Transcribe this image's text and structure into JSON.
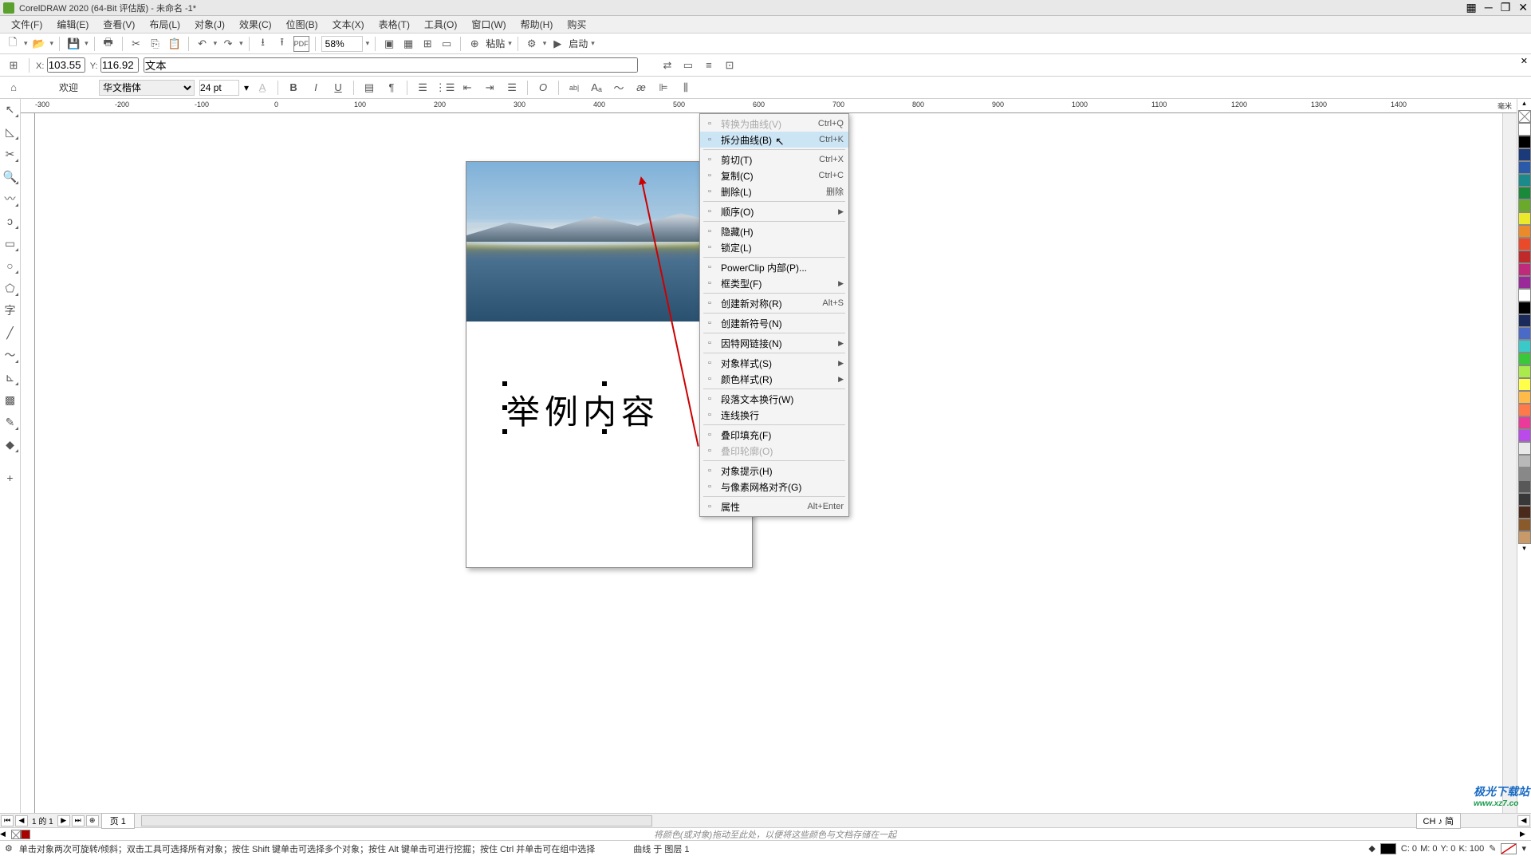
{
  "title": "CorelDRAW 2020 (64-Bit 评估版) - 未命名 -1*",
  "menubar": [
    "文件(F)",
    "编辑(E)",
    "查看(V)",
    "布局(L)",
    "对象(J)",
    "效果(C)",
    "位图(B)",
    "文本(X)",
    "表格(T)",
    "工具(O)",
    "窗口(W)",
    "帮助(H)",
    "购买"
  ],
  "toolbar1": {
    "zoom": "58%",
    "paste_label": "粘贴",
    "launch": "启动"
  },
  "propbar1": {
    "x_label": "X:",
    "x_val": "103.55",
    "y_label": "Y:",
    "y_val": "116.92",
    "obj_label": "文本"
  },
  "propbar2": {
    "greet": "欢迎",
    "font": "华文楷体",
    "fontsize": "24 pt"
  },
  "canvas": {
    "sample_text": "举例内容",
    "ruler_ticks": [
      "-300",
      "-200",
      "-100",
      "0",
      "100",
      "200",
      "300",
      "400",
      "500",
      "600",
      "700",
      "800",
      "900",
      "1000",
      "1100",
      "1200",
      "1300",
      "1400"
    ],
    "ruler_unit": "毫米"
  },
  "context_menu": {
    "items": [
      {
        "label": "转换为曲线(V)",
        "shortcut": "Ctrl+Q",
        "disabled": true
      },
      {
        "label": "拆分曲线(B)",
        "shortcut": "Ctrl+K",
        "highlight": true
      },
      {
        "sep": true
      },
      {
        "label": "剪切(T)",
        "shortcut": "Ctrl+X"
      },
      {
        "label": "复制(C)",
        "shortcut": "Ctrl+C"
      },
      {
        "label": "删除(L)",
        "shortcut": "删除"
      },
      {
        "sep": true
      },
      {
        "label": "顺序(O)",
        "submenu": true
      },
      {
        "sep": true
      },
      {
        "label": "隐藏(H)"
      },
      {
        "label": "锁定(L)"
      },
      {
        "sep": true
      },
      {
        "label": "PowerClip 内部(P)..."
      },
      {
        "label": "框类型(F)",
        "submenu": true
      },
      {
        "sep": true
      },
      {
        "label": "创建新对称(R)",
        "shortcut": "Alt+S"
      },
      {
        "sep": true
      },
      {
        "label": "创建新符号(N)"
      },
      {
        "sep": true
      },
      {
        "label": "因特网链接(N)",
        "submenu": true
      },
      {
        "sep": true
      },
      {
        "label": "对象样式(S)",
        "submenu": true
      },
      {
        "label": "颜色样式(R)",
        "submenu": true
      },
      {
        "sep": true
      },
      {
        "label": "段落文本换行(W)"
      },
      {
        "label": "连线换行"
      },
      {
        "sep": true
      },
      {
        "label": "叠印填充(F)"
      },
      {
        "label": "叠印轮廓(O)",
        "disabled": true
      },
      {
        "sep": true
      },
      {
        "label": "对象提示(H)"
      },
      {
        "label": "与像素网格对齐(G)"
      },
      {
        "sep": true
      },
      {
        "label": "属性",
        "shortcut": "Alt+Enter"
      }
    ]
  },
  "hscroll": {
    "page": "页 1",
    "pageinfo": "1 的 1",
    "lang": "CH ♪ 简"
  },
  "colorbar_hint": "将颜色(或对象)拖动至此处，以便将这些颜色与文档存储在一起",
  "statusbar": {
    "help": "单击对象两次可旋转/倾斜；双击工具可选择所有对象；按住 Shift 键单击可选择多个对象；按住 Alt 键单击可进行挖掘；按住 Ctrl 并单击可在组中选择",
    "obj": "曲线 于 图层 1",
    "cmyk": {
      "c": "C: 0",
      "m": "M: 0",
      "y": "Y: 0",
      "k": "K: 100"
    }
  },
  "palette_colors": [
    "#ffffff",
    "#000000",
    "#1a3a7a",
    "#2a5aa8",
    "#1a8a8a",
    "#1a8a3a",
    "#6aaa2a",
    "#eaea2a",
    "#ea8a2a",
    "#ea4a2a",
    "#c02a2a",
    "#c02a7a",
    "#9a2a9a",
    "#ffffff",
    "#000000",
    "#1a2a5a",
    "#4a6ac8",
    "#3ac8c8",
    "#3ac83a",
    "#aaea4a",
    "#ffff4a",
    "#ffba4a",
    "#ff7a4a",
    "#ea3a9a",
    "#ba4aea",
    "#e8e8e8",
    "#b8b8b8",
    "#888888",
    "#585858",
    "#383838",
    "#4a2a1a",
    "#8a5a2a",
    "#c89a6a"
  ],
  "watermark": {
    "main": "极光下载站",
    "sub": "www.xz7.co"
  }
}
